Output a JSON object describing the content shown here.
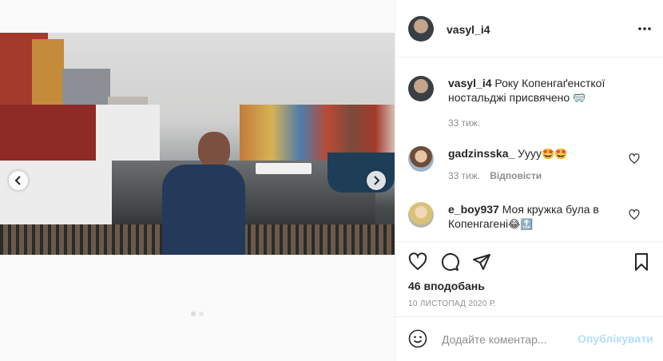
{
  "post": {
    "author": "vasyl_i4",
    "more_icon": "more-horizontal-icon"
  },
  "caption": {
    "username": "vasyl_i4",
    "text": "Року Копенгаґенсткої ностальджі присвячено",
    "emoji": "🥽",
    "time": "33 тиж."
  },
  "comments": [
    {
      "username": "gadzinsska_",
      "text": "Уууу",
      "emoji": "🤩🤩",
      "time": "33 тиж.",
      "reply_label": "Відповісти"
    },
    {
      "username": "e_boy937",
      "text": "Моя кружка була в Копенгагені",
      "emoji": "😂🔝"
    }
  ],
  "actions": {
    "likes": "46 вподобань",
    "date": "10 ЛИСТОПАД 2020 Р."
  },
  "comment_box": {
    "placeholder": "Додайте коментар...",
    "post_label": "Опублікувати"
  },
  "colors": {
    "text": "#262626",
    "muted": "#8e8e8e",
    "post_button_disabled": "#b2dffc",
    "border": "#efefef"
  },
  "carousel": {
    "slide_count": 2,
    "active_slide": 1
  }
}
